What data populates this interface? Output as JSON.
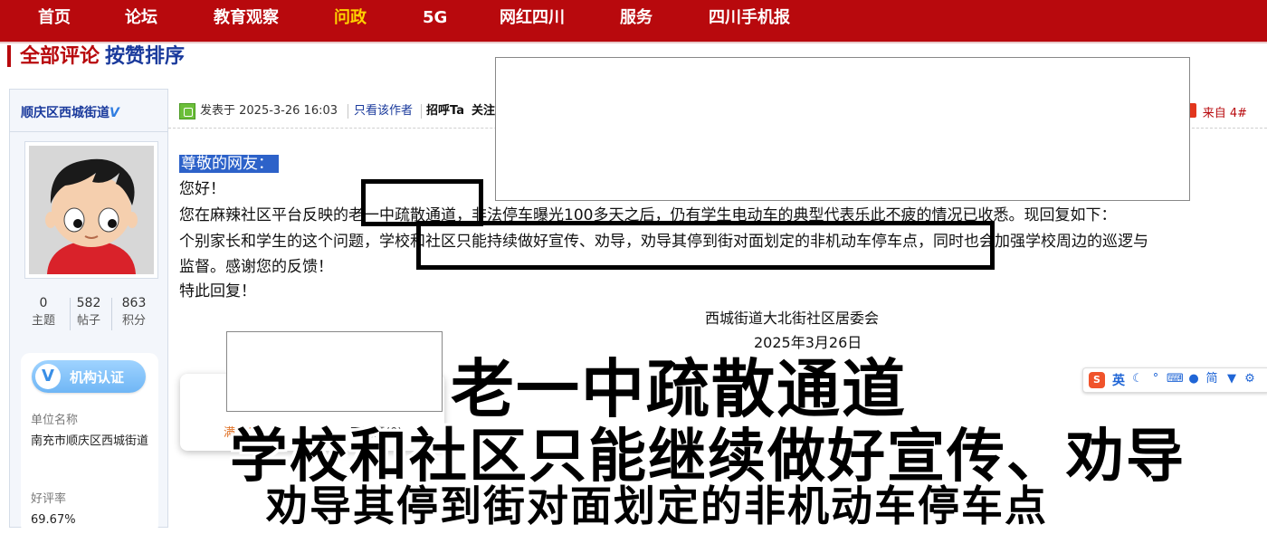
{
  "nav": {
    "items": [
      {
        "label": "首页"
      },
      {
        "label": "论坛"
      },
      {
        "label": "教育观察"
      },
      {
        "label": "问政"
      },
      {
        "label": "5G"
      },
      {
        "label": "网红四川"
      },
      {
        "label": "服务"
      },
      {
        "label": "四川手机报"
      }
    ],
    "active_index": 3
  },
  "section": {
    "all_comments": "全部评论",
    "sort_by_likes": "按赞排序"
  },
  "user": {
    "name": "顺庆区西城街道",
    "verified_mark": "V",
    "stats": [
      {
        "value": "0",
        "label": "主题"
      },
      {
        "value": "582",
        "label": "帖子"
      },
      {
        "value": "863",
        "label": "积分"
      }
    ],
    "cert": {
      "badge_icon": "V",
      "badge_label": "机构认证",
      "unit_label": "单位名称",
      "unit_value": "南充市顺庆区西城街道",
      "rating_label": "好评率",
      "rating_value": "69.67%"
    }
  },
  "post": {
    "posted_at": "发表于 2025-3-26 16:03",
    "only_author": "只看该作者",
    "greet": "招呼Ta",
    "follow": "关注",
    "floor": "来自 4#",
    "lines": [
      "尊敬的网友：",
      "您好！",
      "您在麻辣社区平台反映的老一中疏散通道，非法停车曝光100多天之后，仍有学生电动车的典型代表乐此不疲的情况已收悉。现回复如下：",
      "个别家长和学生的这个问题，学校和社区只能持续做好宣传、劝导，劝导其停到街对面划定的非机动车停车点，同时也会加强学校周边的巡逻与",
      "监督。感谢您的反馈！",
      "特此回复！"
    ],
    "signature": "西城街道大北街社区居委会",
    "sign_date": "2025年3月26日"
  },
  "rating": {
    "satisfied": "满意(0)",
    "unsatisfied": "不满意(0)"
  },
  "ime": {
    "logo": "S",
    "lang": "英"
  },
  "captions": {
    "line1": "老一中疏散通道",
    "line2": "学校和社区只能继续做好宣传、劝导",
    "line3": "劝导其停到街对面划定的非机动车停车点"
  },
  "colors": {
    "nav_bg": "#b8090d",
    "nav_active": "#ffd200",
    "link_blue": "#1a3a9c",
    "highlight_blue": "#2d62c9"
  }
}
